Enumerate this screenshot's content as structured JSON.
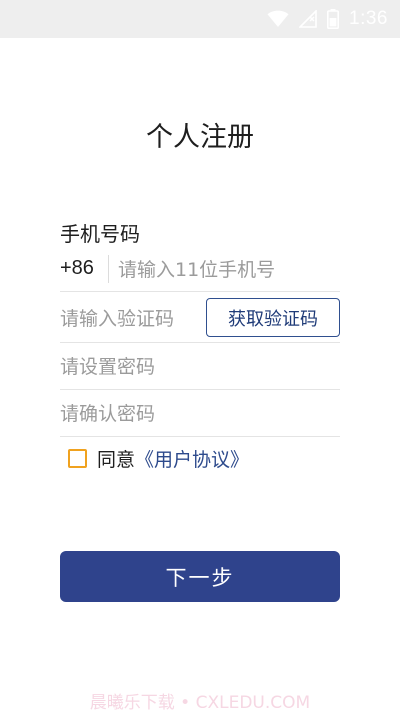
{
  "status_bar": {
    "time": "1:36",
    "icons": [
      "wifi-icon",
      "no-signal-icon",
      "battery-icon"
    ]
  },
  "page": {
    "title": "个人注册"
  },
  "form": {
    "phone_label": "手机号码",
    "phone_prefix": "+86",
    "phone_placeholder": "请输入11位手机号",
    "code_placeholder": "请输入验证码",
    "get_code_label": "获取验证码",
    "password_placeholder": "请设置密码",
    "confirm_placeholder": "请确认密码"
  },
  "agreement": {
    "checked": false,
    "prefix_text": "同意",
    "link_text": "《用户协议》"
  },
  "actions": {
    "next_label": "下一步"
  },
  "watermark": {
    "text": "晨曦乐下载 • CXLEDU.COM"
  },
  "colors": {
    "primary": "#2f438c",
    "link": "#2d4a8c",
    "checkbox_border": "#f0a21f",
    "status_bar_bg": "#eeeeee",
    "divider": "#e4e4e4"
  }
}
